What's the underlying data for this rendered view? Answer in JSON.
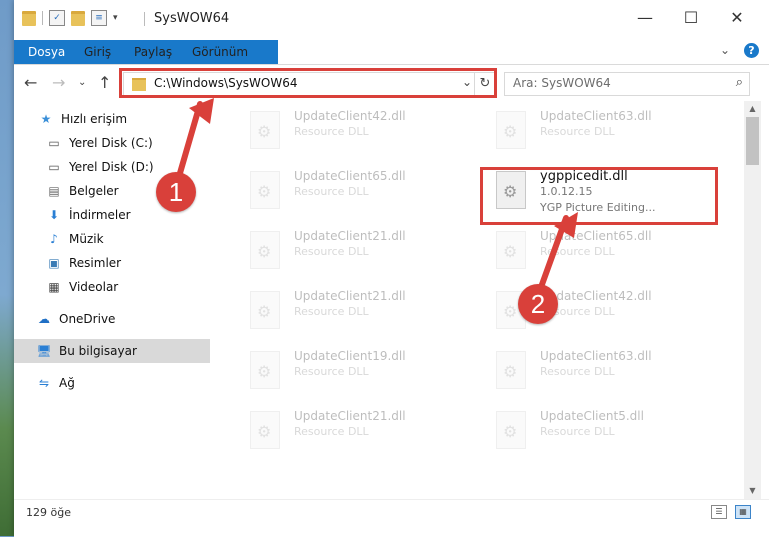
{
  "window": {
    "title": "SysWOW64"
  },
  "ribbon": {
    "tabs": [
      "Dosya",
      "Giriş",
      "Paylaş",
      "Görünüm"
    ],
    "help": "?"
  },
  "window_controls": {
    "minimize": "—",
    "maximize": "☐",
    "close": "✕"
  },
  "nav": {
    "address": "C:\\Windows\\SysWOW64",
    "search_placeholder": "Ara: SysWOW64"
  },
  "sidebar": {
    "items": [
      {
        "label": "Hızlı erişim",
        "icon": "star-icon"
      },
      {
        "label": "Yerel Disk (C:)",
        "icon": "drive-icon"
      },
      {
        "label": "Yerel Disk (D:)",
        "icon": "drive-icon"
      },
      {
        "label": "Belgeler",
        "icon": "documents-icon"
      },
      {
        "label": "İndirmeler",
        "icon": "download-icon"
      },
      {
        "label": "Müzik",
        "icon": "music-icon"
      },
      {
        "label": "Resimler",
        "icon": "pictures-icon"
      },
      {
        "label": "Videolar",
        "icon": "videos-icon"
      },
      {
        "label": "OneDrive",
        "icon": "cloud-icon"
      },
      {
        "label": "Bu bilgisayar",
        "icon": "computer-icon"
      },
      {
        "label": "Ağ",
        "icon": "network-icon"
      }
    ]
  },
  "files": {
    "left": [
      {
        "name": "UpdateClient42.dll",
        "type": "Resource DLL"
      },
      {
        "name": "UpdateClient65.dll",
        "type": "Resource DLL"
      },
      {
        "name": "UpdateClient21.dll",
        "type": "Resource DLL"
      },
      {
        "name": "UpdateClient21.dll",
        "type": "Resource DLL"
      },
      {
        "name": "UpdateClient19.dll",
        "type": "Resource DLL"
      },
      {
        "name": "UpdateClient21.dll",
        "type": "Resource DLL"
      }
    ],
    "right": [
      {
        "name": "UpdateClient63.dll",
        "type": "Resource DLL"
      },
      {
        "name": "UpdateClient65.dll",
        "type": "Resource DLL"
      },
      {
        "name": "UpdateClient42.dll",
        "type": "Resource DLL"
      },
      {
        "name": "UpdateClient63.dll",
        "type": "Resource DLL"
      },
      {
        "name": "UpdateClient5.dll",
        "type": "Resource DLL"
      }
    ],
    "highlighted": {
      "name": "ygppicedit.dll",
      "version": "1.0.12.15",
      "description": "YGP Picture Editing..."
    }
  },
  "status": {
    "item_count": "129 öğe"
  },
  "annotations": {
    "step1": "1",
    "step2": "2"
  },
  "colors": {
    "accent": "#1979ca",
    "annotation": "#d9403a"
  }
}
